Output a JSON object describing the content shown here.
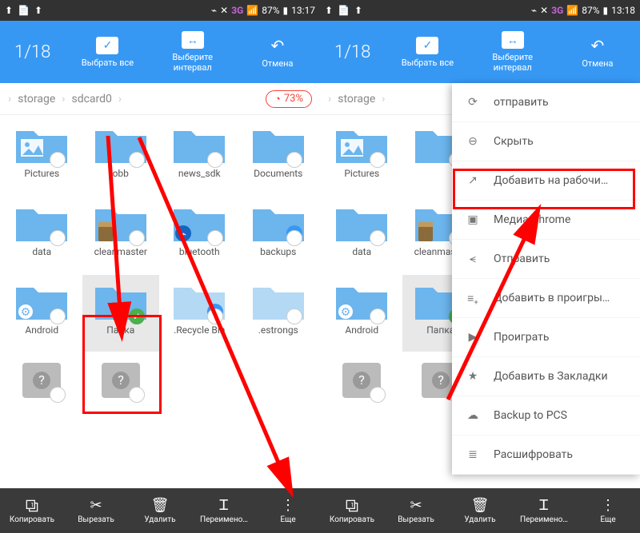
{
  "status": {
    "network": "3G",
    "battery": "87%",
    "time_left": "13:17",
    "time_right": "13:18"
  },
  "toolbar": {
    "counter": "1/18",
    "select_all": "Выбрать все",
    "select_range": "Выберите интервал",
    "cancel": "Отмена"
  },
  "breadcrumb": {
    "item1": "storage",
    "item2": "sdcard0",
    "storage_pct": "73%"
  },
  "folders_left": [
    {
      "label": "Pictures",
      "type": "pictures"
    },
    {
      "label": "obb",
      "type": "folder"
    },
    {
      "label": "news_sdk",
      "type": "folder"
    },
    {
      "label": "Documents",
      "type": "folder"
    },
    {
      "label": "data",
      "type": "folder"
    },
    {
      "label": "cleanmaster",
      "type": "folder",
      "overlay": "brush"
    },
    {
      "label": "bluetooth",
      "type": "folder",
      "overlay": "bt"
    },
    {
      "label": "backups",
      "type": "folder",
      "overlay": "es"
    },
    {
      "label": "Android",
      "type": "folder",
      "overlay": "gear"
    },
    {
      "label": "Папка",
      "type": "folder",
      "selected": true
    },
    {
      "label": ".Recycle Bin",
      "type": "folder-light",
      "overlay": "es"
    },
    {
      "label": ".estrongs",
      "type": "folder-light"
    },
    {
      "label": "",
      "type": "unknown"
    },
    {
      "label": "",
      "type": "unknown"
    }
  ],
  "folders_right": [
    {
      "label": "Pictures",
      "type": "pictures"
    },
    {
      "label": "",
      "type": "folder",
      "cut": true
    },
    {
      "label": "",
      "type": "folder",
      "cut": true
    },
    {
      "label": "",
      "type": "folder",
      "cut": true
    },
    {
      "label": "data",
      "type": "folder"
    },
    {
      "label": "cleanmaster",
      "type": "folder",
      "overlay": "brush",
      "cut": true
    },
    {
      "label": "",
      "type": "folder",
      "cut": true
    },
    {
      "label": "",
      "type": "folder",
      "cut": true
    },
    {
      "label": "Android",
      "type": "folder",
      "overlay": "gear"
    },
    {
      "label": "Папка",
      "type": "folder",
      "selected": true,
      "cut": true
    },
    {
      "label": "",
      "type": "folder",
      "cut": true
    },
    {
      "label": "",
      "type": "folder",
      "cut": true
    },
    {
      "label": "",
      "type": "unknown"
    },
    {
      "label": "",
      "type": "unknown",
      "cut": true
    }
  ],
  "bottom": {
    "copy": "Копировать",
    "cut": "Вырезать",
    "delete": "Удалить",
    "rename": "Переимено…",
    "more": "Еще"
  },
  "menu": [
    {
      "icon": "refresh",
      "label": "отправить"
    },
    {
      "icon": "hide",
      "label": "Скрыть"
    },
    {
      "icon": "shortcut",
      "label": "Добавить на рабочи…"
    },
    {
      "icon": "cast",
      "label": "Медиа Chrome"
    },
    {
      "icon": "share",
      "label": "Отправить"
    },
    {
      "icon": "playlist",
      "label": "Добавить в проигры…"
    },
    {
      "icon": "play",
      "label": "Проиграть"
    },
    {
      "icon": "star",
      "label": "Добавить в Закладки"
    },
    {
      "icon": "cloud",
      "label": "Backup to PCS"
    },
    {
      "icon": "decrypt",
      "label": "Расшифровать"
    }
  ]
}
